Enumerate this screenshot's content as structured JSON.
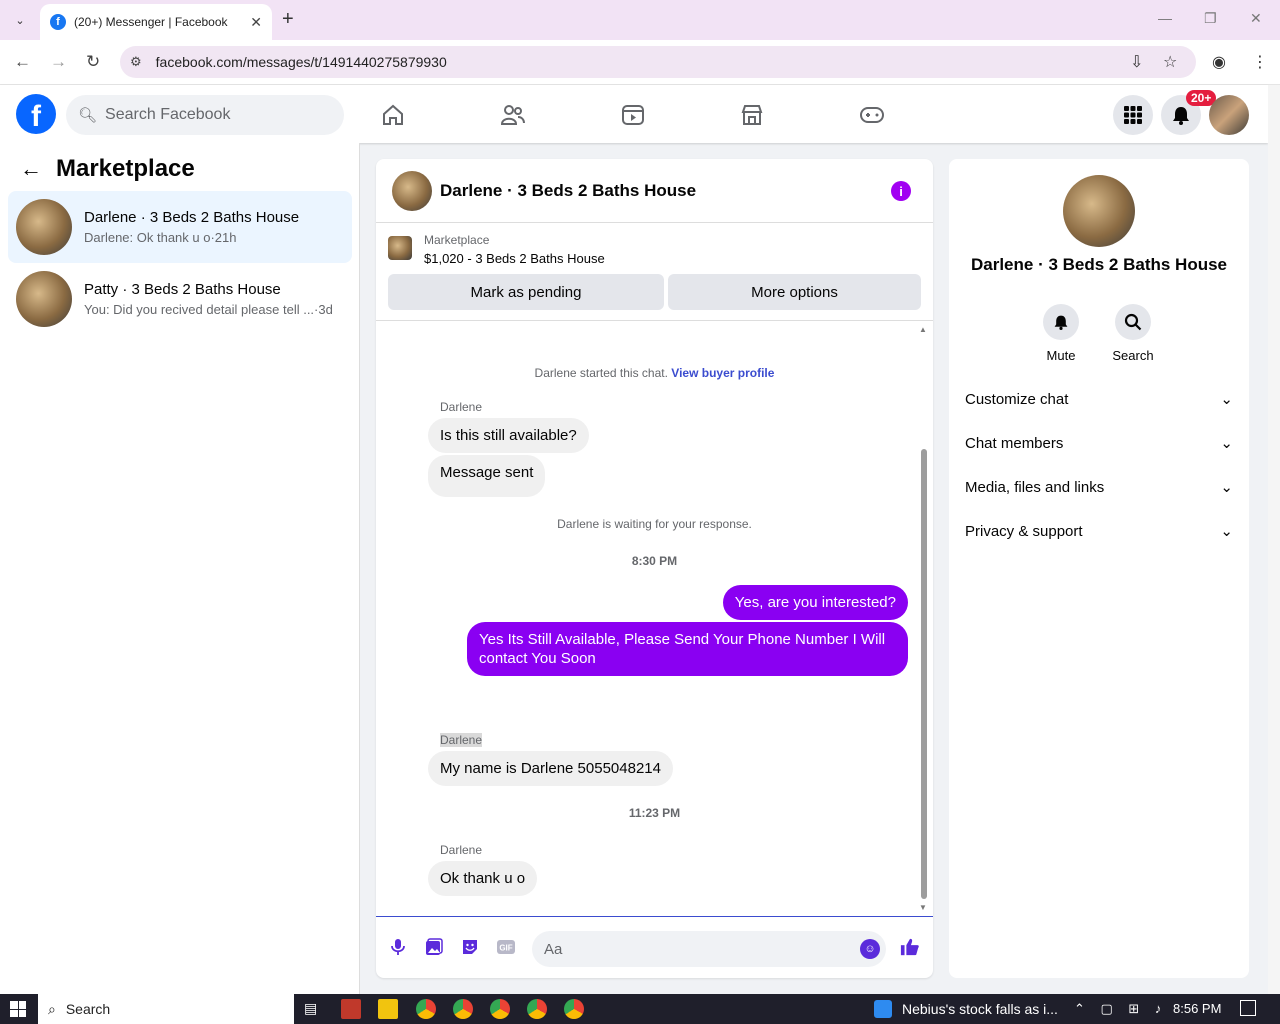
{
  "browser": {
    "tab_title": "(20+) Messenger | Facebook",
    "url": "facebook.com/messages/t/1491440275879930"
  },
  "fb": {
    "search_placeholder": "Search Facebook",
    "notif_badge": "20+"
  },
  "sidebar": {
    "title": "Marketplace",
    "conversations": [
      {
        "name": "Darlene · 3 Beds 2 Baths House",
        "preview": "Darlene: Ok thank u o·21h"
      },
      {
        "name": "Patty · 3 Beds 2 Baths House",
        "preview": "You: Did you recived detail please tell ...·3d"
      }
    ]
  },
  "chat": {
    "title": "Darlene · 3 Beds 2 Baths House",
    "marketplace_label": "Marketplace",
    "listing": "$1,020 - 3 Beds 2 Baths House",
    "mark_pending": "Mark as pending",
    "more_options": "More options",
    "started_text": "Darlene started this chat.",
    "view_profile": "View buyer profile",
    "sender": "Darlene",
    "msg1": "Is this still available?",
    "msg2": "Message sent",
    "waiting": "Darlene is waiting for your response.",
    "time1": "8:30 PM",
    "out1": "Yes, are you interested?",
    "out2": "Yes Its Still Available, Please Send Your Phone Number I Will contact You Soon",
    "msg3": "My name is Darlene 5055048214",
    "time2": "11:23 PM",
    "msg4": "Ok thank u o",
    "input_placeholder": "Aa"
  },
  "details": {
    "name": "Darlene · 3 Beds 2 Baths House",
    "mute": "Mute",
    "search": "Search",
    "rows": [
      "Customize chat",
      "Chat members",
      "Media, files and links",
      "Privacy & support"
    ]
  },
  "taskbar": {
    "search": "Search",
    "news": "Nebius's stock falls as i...",
    "time": "8:56 PM"
  }
}
